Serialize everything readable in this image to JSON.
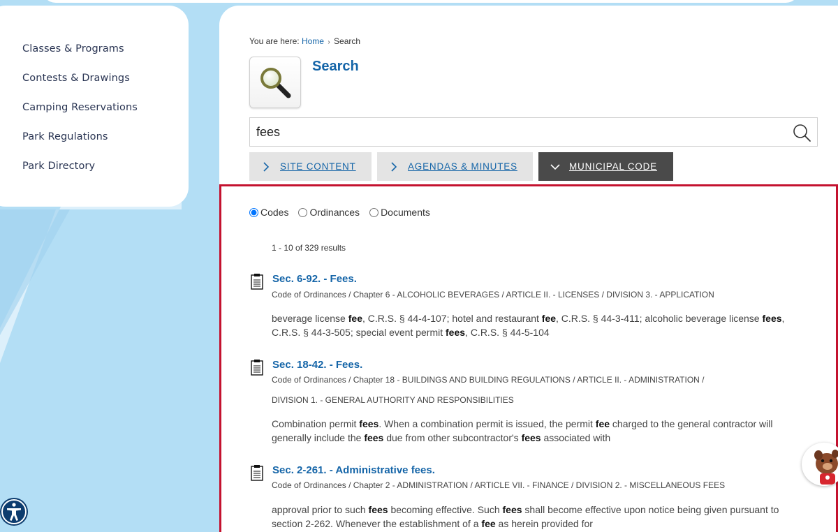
{
  "sidebar": {
    "items": [
      {
        "label": "Classes & Programs"
      },
      {
        "label": "Contests & Drawings"
      },
      {
        "label": "Camping Reservations"
      },
      {
        "label": "Park Regulations"
      },
      {
        "label": "Park Directory"
      }
    ]
  },
  "breadcrumb": {
    "prefix": "You are here:",
    "home": "Home",
    "separator": "›",
    "current": "Search"
  },
  "page": {
    "title": "Search",
    "icon": "magnifier-icon"
  },
  "search": {
    "value": "fees",
    "placeholder": ""
  },
  "tabs": [
    {
      "label": "Site Content",
      "active": false
    },
    {
      "label": "Agendas & Minutes",
      "active": false
    },
    {
      "label": "Municipal Code",
      "active": true
    }
  ],
  "filters": {
    "options": [
      "Codes",
      "Ordinances",
      "Documents"
    ],
    "selected": "Codes"
  },
  "results": {
    "count_text": "1 - 10 of 329 results",
    "items": [
      {
        "title": "Sec. 6-92. - Fees.",
        "path": "Code of Ordinances / Chapter 6 - ALCOHOLIC BEVERAGES / ARTICLE II. - LICENSES / DIVISION 3. - APPLICATION",
        "snippet_parts": [
          {
            "t": "beverage license ",
            "b": false
          },
          {
            "t": "fee",
            "b": true
          },
          {
            "t": ", C.R.S. § 44-4-107; hotel and restaurant ",
            "b": false
          },
          {
            "t": "fee",
            "b": true
          },
          {
            "t": ", C.R.S. § 44-3-411; alcoholic beverage license ",
            "b": false
          },
          {
            "t": "fees",
            "b": true
          },
          {
            "t": ", C.R.S. § 44-3-505; special event permit ",
            "b": false
          },
          {
            "t": "fees",
            "b": true
          },
          {
            "t": ", C.R.S. § 44-5-104",
            "b": false
          }
        ]
      },
      {
        "title": "Sec. 18-42. - Fees.",
        "path": "Code of Ordinances / Chapter 18 - BUILDINGS AND BUILDING REGULATIONS / ARTICLE II. - ADMINISTRATION /",
        "path2": "DIVISION 1. - GENERAL AUTHORITY AND RESPONSIBILITIES",
        "snippet_parts": [
          {
            "t": "Combination permit ",
            "b": false
          },
          {
            "t": "fees",
            "b": true
          },
          {
            "t": ". When a combination permit is issued, the permit ",
            "b": false
          },
          {
            "t": "fee",
            "b": true
          },
          {
            "t": " charged to the general contractor will generally include the ",
            "b": false
          },
          {
            "t": "fees",
            "b": true
          },
          {
            "t": " due from other subcontractor's ",
            "b": false
          },
          {
            "t": "fees",
            "b": true
          },
          {
            "t": " associated with",
            "b": false
          }
        ]
      },
      {
        "title": "Sec. 2-261. - Administrative fees.",
        "path": "Code of Ordinances / Chapter 2 - ADMINISTRATION / ARTICLE VII. - FINANCE / DIVISION 2. - MISCELLANEOUS FEES",
        "snippet_parts": [
          {
            "t": "approval prior to such ",
            "b": false
          },
          {
            "t": "fees",
            "b": true
          },
          {
            "t": " becoming effective. Such ",
            "b": false
          },
          {
            "t": "fees",
            "b": true
          },
          {
            "t": " shall become effective upon notice being given pursuant to section 2-262. Whenever the establishment of a ",
            "b": false
          },
          {
            "t": "fee",
            "b": true
          },
          {
            "t": " as herein provided for",
            "b": false
          }
        ]
      }
    ]
  },
  "colors": {
    "link": "#1565a8",
    "active_tab": "#4a4a4a",
    "highlight_border": "#c4122f",
    "background": "#b3def5"
  }
}
